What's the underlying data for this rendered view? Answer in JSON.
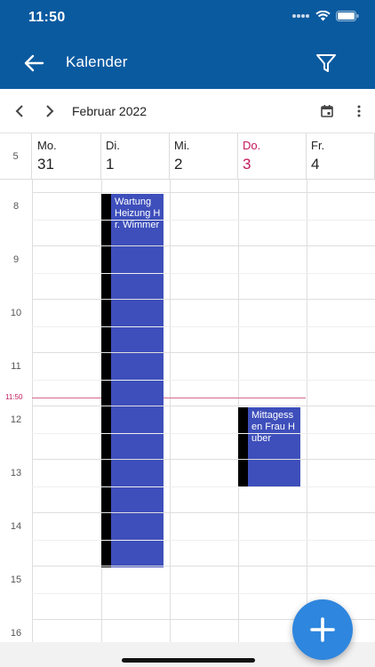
{
  "status_bar": {
    "time": "11:50"
  },
  "app_bar": {
    "title": "Kalender"
  },
  "toolbar": {
    "month": "Februar 2022"
  },
  "calendar": {
    "week_number": "5",
    "days": [
      {
        "name": "Mo.",
        "num": "31",
        "today": false
      },
      {
        "name": "Di.",
        "num": "1",
        "today": false
      },
      {
        "name": "Mi.",
        "num": "2",
        "today": false
      },
      {
        "name": "Do.",
        "num": "3",
        "today": true
      },
      {
        "name": "Fr.",
        "num": "4",
        "today": false
      }
    ],
    "hours": [
      "8",
      "9",
      "10",
      "11",
      "12",
      "13",
      "14",
      "15",
      "16"
    ],
    "now_time": "11:50",
    "events": [
      {
        "title": "Wartung Heizung Hr. Wimmer",
        "day": "Di.",
        "start": "08:00",
        "end": "15:00"
      },
      {
        "title": "Mittagessen Frau Huber",
        "day": "Do.",
        "start": "12:00",
        "end": "13:30"
      }
    ]
  },
  "colors": {
    "app_bar": "#0a5aa0",
    "event": "#3e4fbb",
    "today": "#c2185b",
    "fab": "#2e86de"
  }
}
